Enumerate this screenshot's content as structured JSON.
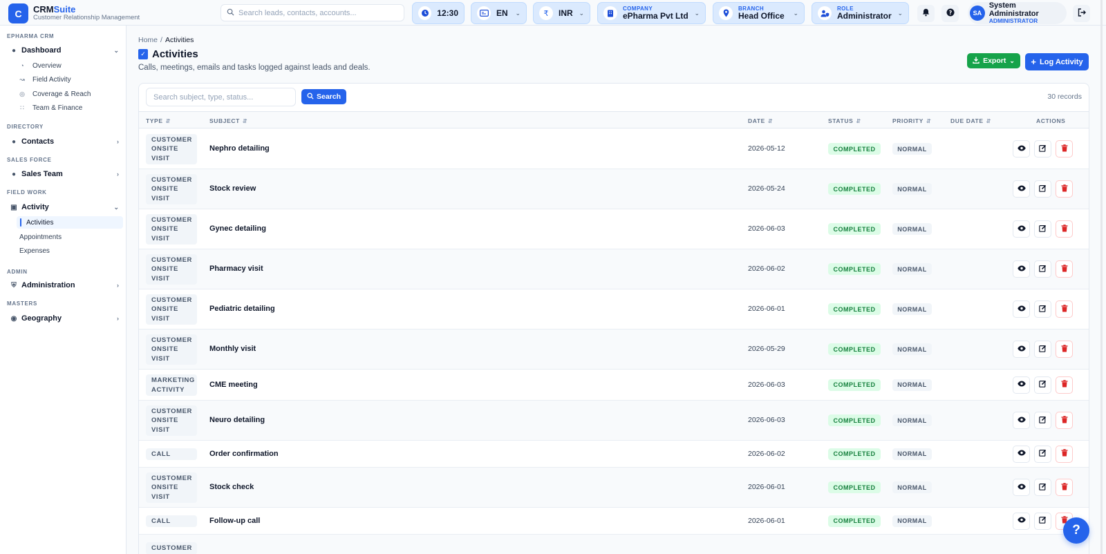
{
  "brand": {
    "logo_letter": "C",
    "name_prefix": "CRM",
    "name_suffix": "Suite",
    "subtitle": "Customer Relationship Management",
    "accent": "#2563eb"
  },
  "topbar": {
    "search_placeholder": "Search leads, contacts, accounts...",
    "time": "12:30",
    "language": "EN",
    "currency": "INR",
    "company": {
      "caption": "COMPANY",
      "value": "ePharma Pvt Ltd"
    },
    "branch": {
      "caption": "BRANCH",
      "value": "Head Office"
    },
    "role": {
      "caption": "ROLE",
      "value": "Administrator"
    },
    "user": {
      "initials": "SA",
      "name": "System Administrator",
      "role": "ADMINISTRATOR"
    }
  },
  "sidebar": {
    "sections": {
      "crm": "EPHARMA CRM",
      "directory": "DIRECTORY",
      "sales_force": "SALES FORCE",
      "field_work": "FIELD WORK",
      "admin": "ADMIN",
      "masters": "MASTERS"
    },
    "dashboard": {
      "label": "Dashboard",
      "items": [
        "Overview",
        "Field Activity",
        "Coverage & Reach",
        "Team & Finance"
      ]
    },
    "contacts": "Contacts",
    "sales_team": "Sales Team",
    "activity": {
      "label": "Activity",
      "items": [
        "Activities",
        "Appointments",
        "Expenses"
      ]
    },
    "administration": "Administration",
    "geography": "Geography"
  },
  "breadcrumb": {
    "home": "Home",
    "separator": "/",
    "current": "Activities"
  },
  "page": {
    "title": "Activities",
    "subtitle": "Calls, meetings, emails and tasks logged against leads and deals.",
    "export_label": "Export",
    "log_label": "Log Activity"
  },
  "table": {
    "search_placeholder": "Search subject, type, status...",
    "search_button": "Search",
    "records": "30 records",
    "columns": {
      "type": "TYPE",
      "subject": "SUBJECT",
      "date": "DATE",
      "status": "STATUS",
      "priority": "PRIORITY",
      "due_date": "DUE DATE",
      "actions": "ACTIONS"
    },
    "rows": [
      {
        "type": "CUSTOMER ONSITE VISIT",
        "subject": "Nephro detailing",
        "date": "2026-05-12",
        "status": "COMPLETED",
        "priority": "NORMAL",
        "due": ""
      },
      {
        "type": "CUSTOMER ONSITE VISIT",
        "subject": "Stock review",
        "date": "2026-05-24",
        "status": "COMPLETED",
        "priority": "NORMAL",
        "due": ""
      },
      {
        "type": "CUSTOMER ONSITE VISIT",
        "subject": "Gynec detailing",
        "date": "2026-06-03",
        "status": "COMPLETED",
        "priority": "NORMAL",
        "due": ""
      },
      {
        "type": "CUSTOMER ONSITE VISIT",
        "subject": "Pharmacy visit",
        "date": "2026-06-02",
        "status": "COMPLETED",
        "priority": "NORMAL",
        "due": ""
      },
      {
        "type": "CUSTOMER ONSITE VISIT",
        "subject": "Pediatric detailing",
        "date": "2026-06-01",
        "status": "COMPLETED",
        "priority": "NORMAL",
        "due": ""
      },
      {
        "type": "CUSTOMER ONSITE VISIT",
        "subject": "Monthly visit",
        "date": "2026-05-29",
        "status": "COMPLETED",
        "priority": "NORMAL",
        "due": ""
      },
      {
        "type": "MARKETING ACTIVITY",
        "subject": "CME meeting",
        "date": "2026-06-03",
        "status": "COMPLETED",
        "priority": "NORMAL",
        "due": ""
      },
      {
        "type": "CUSTOMER ONSITE VISIT",
        "subject": "Neuro detailing",
        "date": "2026-06-03",
        "status": "COMPLETED",
        "priority": "NORMAL",
        "due": ""
      },
      {
        "type": "CALL",
        "subject": "Order confirmation",
        "date": "2026-06-02",
        "status": "COMPLETED",
        "priority": "NORMAL",
        "due": ""
      },
      {
        "type": "CUSTOMER ONSITE VISIT",
        "subject": "Stock check",
        "date": "2026-06-01",
        "status": "COMPLETED",
        "priority": "NORMAL",
        "due": ""
      },
      {
        "type": "CALL",
        "subject": "Follow-up call",
        "date": "2026-06-01",
        "status": "COMPLETED",
        "priority": "NORMAL",
        "due": ""
      },
      {
        "type": "CUSTOMER",
        "subject": "",
        "date": "",
        "status": "",
        "priority": "",
        "due": ""
      }
    ]
  },
  "help_label": "?",
  "colors": {
    "primary": "#2563eb",
    "success": "#16a34a",
    "status_bg": "#dcfce7",
    "danger": "#dc2626"
  }
}
